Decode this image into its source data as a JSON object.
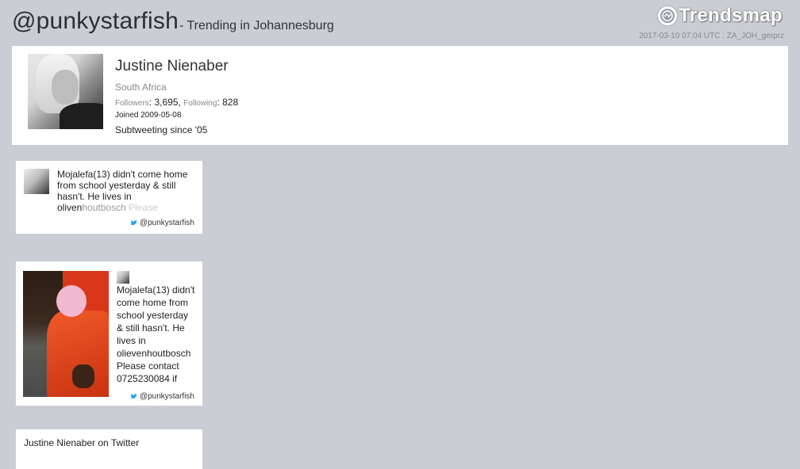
{
  "header": {
    "handle": "@punkystarfish",
    "subtitle": "- Trending in Johannesburg",
    "logo_text": "Trendsmap",
    "logo_icon": "trendsmap-globe-icon",
    "timestamp": "2017-03-10 07:04 UTC : ZA_JOH_gerprz"
  },
  "profile": {
    "name": "Justine Nienaber",
    "location": "South Africa",
    "followers_label": "Followers",
    "followers_value": "3,695",
    "following_label": "Following",
    "following_value": "828",
    "joined": "Joined 2009-05-08",
    "bio": "Subtweeting since '05"
  },
  "tweets": [
    {
      "text_main": "Mojalefa(13) didn't come home from school yesterday & still hasn't. He lives in oliven",
      "text_fade1": "houtbosch",
      "text_fade2": " Please",
      "handle": "@punkystarfish"
    },
    {
      "text": "Mojalefa(13) didn't come home from school yesterday & still hasn't. He lives in olievenhoutbosch Please contact 0725230084 if",
      "handle": "@punkystarfish"
    },
    {
      "title": "Justine Nienaber on Twitter"
    }
  ],
  "colors": {
    "background": "#cbcdd5",
    "card": "#ffffff",
    "twitter_blue": "#1da1f2"
  }
}
